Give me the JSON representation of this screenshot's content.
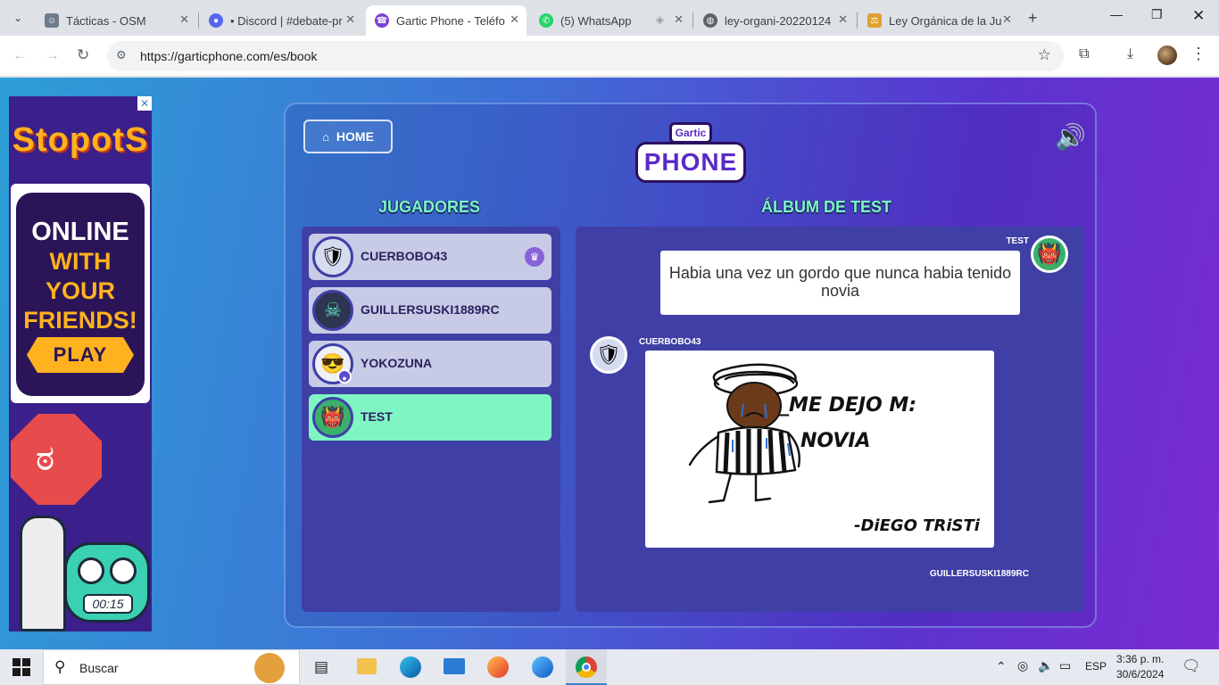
{
  "browser": {
    "tabs": [
      {
        "title": "Tácticas - OSM",
        "icon": "osm-favicon",
        "color": "#6d7b8c"
      },
      {
        "title": "• Discord | #debate-pr",
        "icon": "discord-favicon",
        "color": "#5865f2"
      },
      {
        "title": "Gartic Phone - Teléfo",
        "icon": "gartic-favicon",
        "color": "#7e3fd6"
      },
      {
        "title": "(5) WhatsApp",
        "icon": "whatsapp-favicon",
        "color": "#25d366"
      },
      {
        "title": "ley-organi-20220124",
        "icon": "globe-favicon",
        "color": "#5f6368"
      },
      {
        "title": "Ley Orgánica de la Ju",
        "icon": "law-favicon",
        "color": "#e0a030"
      }
    ],
    "active_tab": 2,
    "url": "https://garticphone.com/es/book"
  },
  "ad": {
    "brand": "StopotS",
    "line1": "ONLINE",
    "line2": "WITH",
    "line3": "YOUR",
    "line4": "FRIENDS!",
    "play": "PLAY",
    "timer": "00:15",
    "close": "✕"
  },
  "game": {
    "home_label": "HOME",
    "logo_top": "Gartic",
    "logo_main": "PHONE",
    "players_title": "JUGADORES",
    "album_title": "ÁLBUM DE TEST",
    "players": [
      {
        "name": "CUERBOBO43",
        "avatar": "knight-icon",
        "host": true
      },
      {
        "name": "GUILLERSUSKI1889RC",
        "avatar": "robot-icon",
        "host": false
      },
      {
        "name": "YOKOZUNA",
        "avatar": "sunglasses-icon",
        "host": false,
        "badge": true
      },
      {
        "name": "TEST",
        "avatar": "demon-icon",
        "host": false,
        "active": true
      }
    ],
    "album": {
      "text_author": "TEST",
      "text": "Habia una vez un gordo que nunca habia tenido novia",
      "drawing_author": "CUERBOBO43",
      "drawing_text_1": "_ME DEJO M:",
      "drawing_text_2": "NOVIA",
      "drawing_text_3": "-DiEGO TRiSTi",
      "next_author": "GUILLERSUSKI1889RC"
    }
  },
  "taskbar": {
    "search_placeholder": "Buscar",
    "language": "ESP",
    "time": "3:36 p. m.",
    "date": "30/6/2024"
  }
}
